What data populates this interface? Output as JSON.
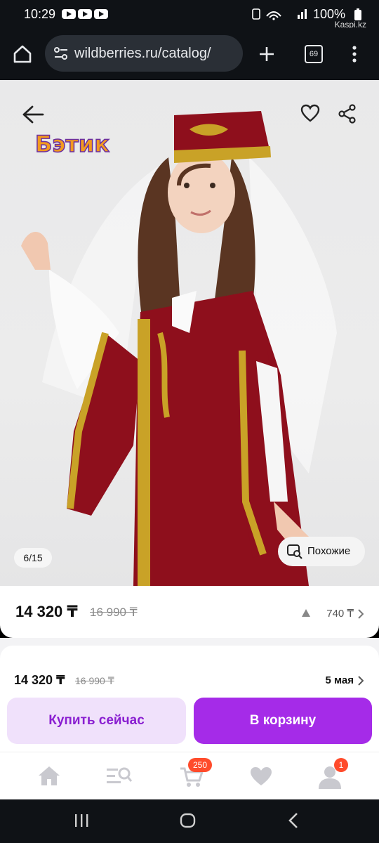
{
  "status_bar": {
    "time": "10:29",
    "battery": "100%",
    "overlay_label": "Kaspi.kz"
  },
  "browser": {
    "url": "wildberries.ru/catalog/",
    "tab_count": "69"
  },
  "product": {
    "brand_logo": "Бэтик",
    "image_counter": "6/15",
    "similar_label": "Похожие",
    "price": "14 320 ₸",
    "old_price": "16 990 ₸",
    "price_delta": "740 ₸"
  },
  "purchase_panel": {
    "price": "14 320 ₸",
    "old_price": "16 990 ₸",
    "delivery_date": "5 мая",
    "buy_now_label": "Купить сейчас",
    "add_to_cart_label": "В корзину"
  },
  "bottom_nav": {
    "cart_badge": "250",
    "profile_badge": "1"
  },
  "colors": {
    "accent": "#a52be8",
    "accent_light": "#f0e1fb",
    "badge": "#ff4b2b",
    "dress_red": "#8e0f1c",
    "gold": "#c9a227"
  }
}
